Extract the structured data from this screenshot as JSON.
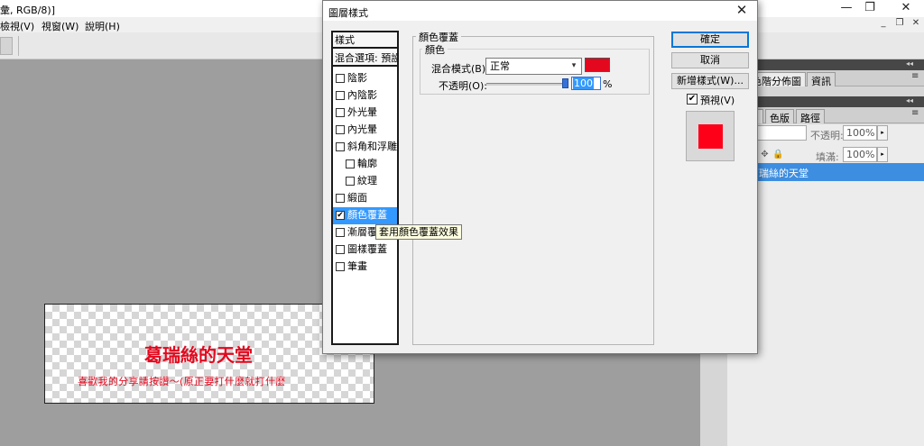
{
  "app": {
    "title_fragment": "彙, RGB/8)]",
    "window_controls": {
      "minimize": "—",
      "restore": "❐",
      "close": "✕"
    },
    "menu": [
      "檢視(V)",
      "視窗(W)",
      "說明(H)"
    ],
    "doc_controls": {
      "minimize": "_",
      "restore": "❐",
      "close": "✕"
    }
  },
  "canvas": {
    "heading": "葛瑞絲的天堂",
    "subline": "喜歡我的分享請按讚～(原正要打什麼就打什麼"
  },
  "panels": {
    "collapse": "◂◂",
    "top_tabs": [
      "器",
      "色階分佈圖",
      "資訊"
    ],
    "layer_tabs": [
      "",
      "色版",
      "路徑"
    ],
    "menu_icon": "≡",
    "opacity_label": "不透明:",
    "opacity_value": "100%",
    "fill_label": "填滿:",
    "fill_value": "100%",
    "arrow": "▸",
    "layer_name": "葛瑞絲的天堂",
    "lock_icons": [
      "☒",
      "✎",
      "✥",
      "🔒"
    ]
  },
  "dialog": {
    "title": "圖層樣式",
    "close_glyph": "✕",
    "styles_header": "樣式",
    "blending_header": "混合選項: 預設",
    "style_items": [
      {
        "label": "陰影",
        "checked": false,
        "indent": false
      },
      {
        "label": "內陰影",
        "checked": false,
        "indent": false
      },
      {
        "label": "外光暈",
        "checked": false,
        "indent": false
      },
      {
        "label": "內光暈",
        "checked": false,
        "indent": false
      },
      {
        "label": "斜角和浮雕",
        "checked": false,
        "indent": false
      },
      {
        "label": "輪廓",
        "checked": false,
        "indent": true
      },
      {
        "label": "紋理",
        "checked": false,
        "indent": true
      },
      {
        "label": "緞面",
        "checked": false,
        "indent": false
      },
      {
        "label": "顏色覆蓋",
        "checked": true,
        "indent": false,
        "selected": true
      },
      {
        "label": "漸層覆蓋",
        "checked": false,
        "indent": false
      },
      {
        "label": "圖樣覆蓋",
        "checked": false,
        "indent": false
      },
      {
        "label": "筆畫",
        "checked": false,
        "indent": false
      }
    ],
    "tooltip": "套用顏色覆蓋效果",
    "color_overlay_title": "顏色覆蓋",
    "color_group_title": "顏色",
    "blend_mode_label": "混合模式(B):",
    "blend_mode_value": "正常",
    "blend_chevron": "▾",
    "overlay_color": "#e3081e",
    "opacity_label": "不透明(O):",
    "opacity_value": "100",
    "opacity_unit": "%",
    "opacity_level": 100,
    "buttons": {
      "ok": "確定",
      "cancel": "取消",
      "new_style": "新增樣式(W)..."
    },
    "preview_label": "預視(V)",
    "preview_checked": true,
    "check_glyph": "✔"
  }
}
